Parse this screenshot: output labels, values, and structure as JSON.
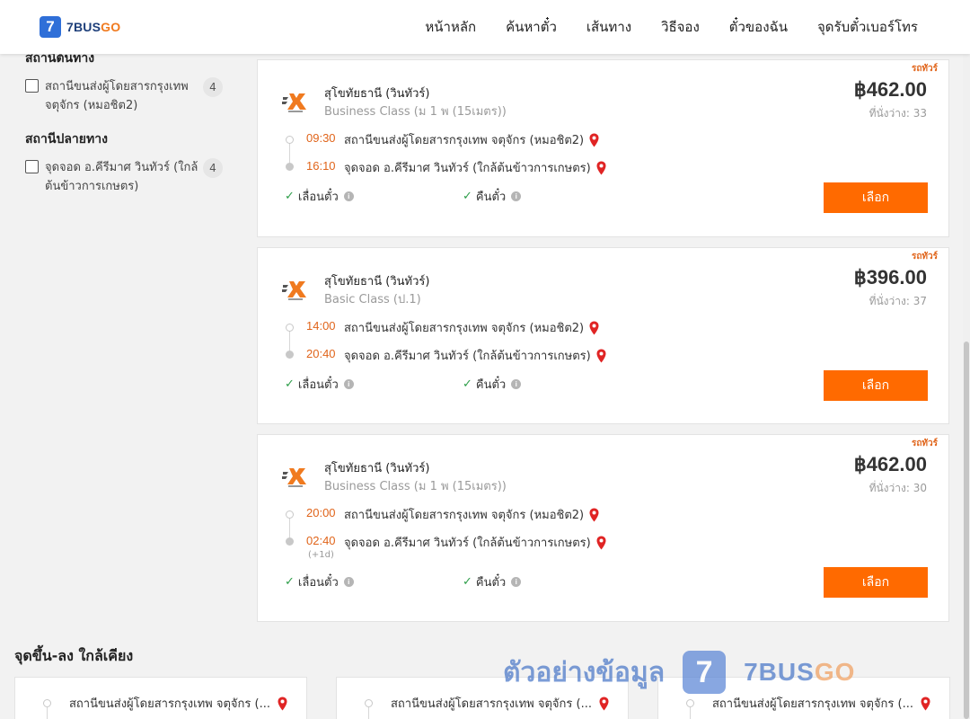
{
  "header": {
    "logo_text": "7BUS",
    "logo_text_go": "GO",
    "logo_mark": "7",
    "nav": [
      "หน้าหลัก",
      "ค้นหาตั๋ว",
      "เส้นทาง",
      "วิธีจอง",
      "ตั๋วของฉัน",
      "จุดรับตั๋วเบอร์โทร"
    ]
  },
  "sidebar": {
    "origin_heading": "สถานีต้นทาง",
    "origin_filters": [
      {
        "label": "สถานีขนส่งผู้โดยสารกรุงเทพ จตุจักร (หมอชิต2)",
        "count": "4"
      }
    ],
    "dest_heading": "สถานีปลายทาง",
    "dest_filters": [
      {
        "label": "จุดจอด อ.คีรีมาศ วินทัวร์ (ใกล้ต้นข้าวการเกษตร)",
        "count": "4"
      }
    ]
  },
  "trips": [
    {
      "tag": "รถทัวร์",
      "operator": "สุโขทัยธานี (วินทัวร์)",
      "bus_class": "Business Class (ม 1 พ (15เมตร))",
      "price": "฿462.00",
      "seats": "ที่นั่งว่าง: 33",
      "dep_time": "09:30",
      "dep_stop": "สถานีขนส่งผู้โดยสารกรุงเทพ จตุจักร (หมอชิต2)",
      "arr_time": "16:10",
      "arr_stop": "จุดจอด อ.คีรีมาศ วินทัวร์ (ใกล้ต้นข้าวการเกษตร)",
      "feature_change": "เลื่อนตั๋ว",
      "feature_refund": "คืนตั๋ว",
      "select_label": "เลือก"
    },
    {
      "tag": "รถทัวร์",
      "operator": "สุโขทัยธานี (วินทัวร์)",
      "bus_class": "Basic Class (ป.1)",
      "price": "฿396.00",
      "seats": "ที่นั่งว่าง: 37",
      "dep_time": "14:00",
      "dep_stop": "สถานีขนส่งผู้โดยสารกรุงเทพ จตุจักร (หมอชิต2)",
      "arr_time": "20:40",
      "arr_stop": "จุดจอด อ.คีรีมาศ วินทัวร์ (ใกล้ต้นข้าวการเกษตร)",
      "feature_change": "เลื่อนตั๋ว",
      "feature_refund": "คืนตั๋ว",
      "select_label": "เลือก"
    },
    {
      "tag": "รถทัวร์",
      "operator": "สุโขทัยธานี (วินทัวร์)",
      "bus_class": "Business Class (ม 1 พ (15เมตร))",
      "price": "฿462.00",
      "seats": "ที่นั่งว่าง: 30",
      "dep_time": "20:00",
      "dep_stop": "สถานีขนส่งผู้โดยสารกรุงเทพ จตุจักร (หมอชิต2)",
      "arr_time": "02:40",
      "arr_stop": "จุดจอด อ.คีรีมาศ วินทัวร์ (ใกล้ต้นข้าวการเกษตร)",
      "next_day": "(+1d)",
      "feature_change": "เลื่อนตั๋ว",
      "feature_refund": "คืนตั๋ว",
      "select_label": "เลือก"
    }
  ],
  "nearby": {
    "title": "จุดขึ้น-ลง ใกล้เคียง",
    "stops": [
      "สถานีขนส่งผู้โดยสารกรุงเทพ จตุจักร (...",
      "สถานีขนส่งผู้โดยสารกรุงเทพ จตุจักร (...",
      "สถานีขนส่งผู้โดยสารกรุงเทพ จตุจักร (..."
    ]
  },
  "watermark": {
    "text": "ตัวอย่างข้อมูล",
    "logo_mark": "7",
    "brand": "7BUS",
    "brand_go": "GO"
  },
  "info_glyph": "i",
  "check_glyph": "✓",
  "colors": {
    "accent_orange": "#ff6a00",
    "time_orange": "#e0641a",
    "pin_red": "#e02424",
    "brand_blue": "#2f6fd8",
    "check_green": "#2e9e4a"
  }
}
